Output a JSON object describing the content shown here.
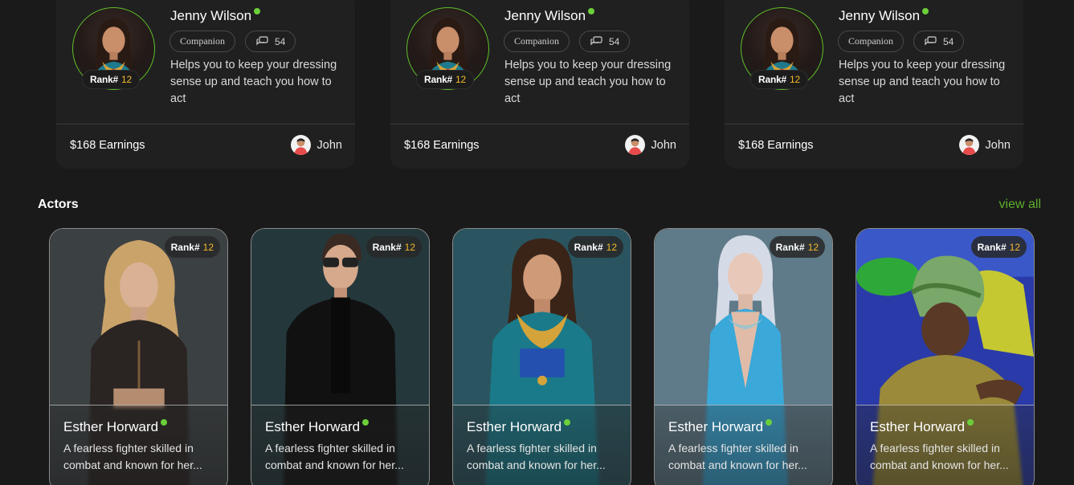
{
  "companions": [
    {
      "name": "Jenny Wilson",
      "rank_label": "Rank#",
      "rank_value": "12",
      "category": "Companion",
      "chat_count": "54",
      "description": "Helps you to keep your dressing sense up and teach you how to act",
      "earnings": "$168 Earnings",
      "owner": "John"
    },
    {
      "name": "Jenny Wilson",
      "rank_label": "Rank#",
      "rank_value": "12",
      "category": "Companion",
      "chat_count": "54",
      "description": "Helps you to keep your dressing sense up and teach you how to act",
      "earnings": "$168 Earnings",
      "owner": "John"
    },
    {
      "name": "Jenny Wilson",
      "rank_label": "Rank#",
      "rank_value": "12",
      "category": "Companion",
      "chat_count": "54",
      "description": "Helps you to keep your dressing sense up and teach you how to act",
      "earnings": "$168 Earnings",
      "owner": "John"
    }
  ],
  "actors_section": {
    "title": "Actors",
    "view_all": "view all"
  },
  "actors": [
    {
      "name": "Esther Horward",
      "rank_label": "Rank#",
      "rank_value": "12",
      "description": "A fearless fighter skilled in combat and known for her..."
    },
    {
      "name": "Esther Horward",
      "rank_label": "Rank#",
      "rank_value": "12",
      "description": "A fearless fighter skilled in combat and known for her..."
    },
    {
      "name": "Esther Horward",
      "rank_label": "Rank#",
      "rank_value": "12",
      "description": "A fearless fighter skilled in combat and known for her..."
    },
    {
      "name": "Esther Horward",
      "rank_label": "Rank#",
      "rank_value": "12",
      "description": "A fearless fighter skilled in combat and known for her..."
    },
    {
      "name": "Esther Horward",
      "rank_label": "Rank#",
      "rank_value": "12",
      "description": "A fearless fighter skilled in combat and known for her..."
    }
  ],
  "colors": {
    "background": "#1a1a1a",
    "card": "#202020",
    "accent_green": "#5fae2c",
    "online_dot": "#6bcf3a",
    "rank_number": "#f3b92a"
  },
  "icons": {
    "online": "online-status-dot",
    "chat": "chat-bubbles-icon"
  }
}
